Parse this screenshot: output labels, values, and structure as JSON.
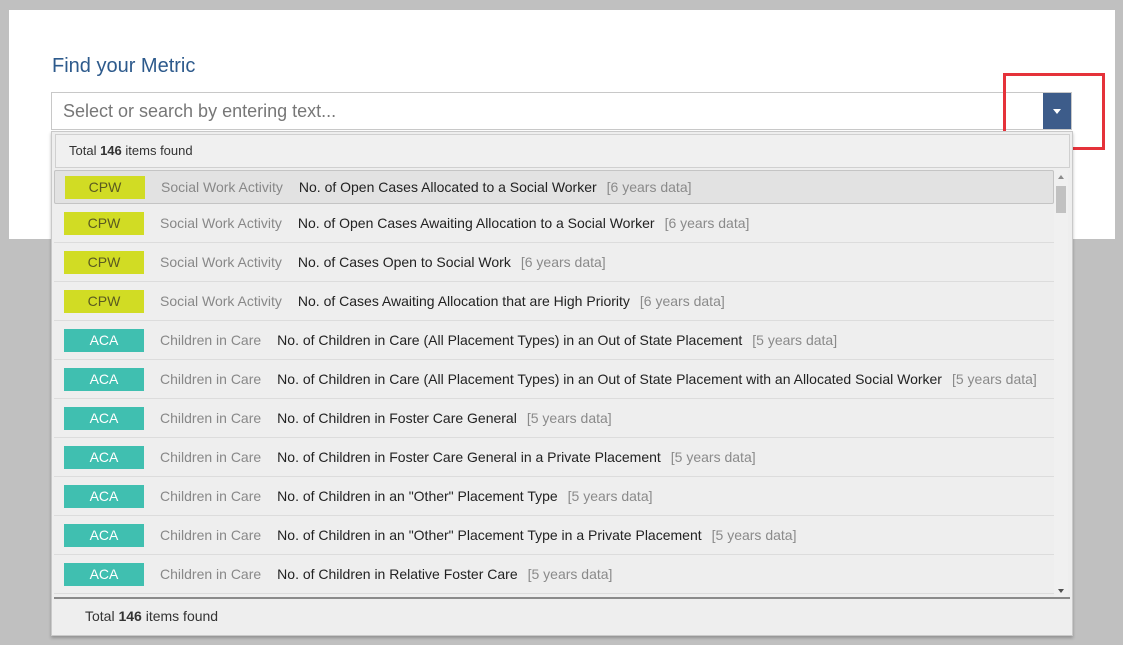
{
  "heading": "Find your Metric",
  "search": {
    "placeholder": "Select or search by entering text...",
    "value": ""
  },
  "total_top": {
    "prefix": "Total ",
    "count": "146",
    "suffix": " items found"
  },
  "total_bottom": {
    "prefix": "Total ",
    "count": "146",
    "suffix": " items found"
  },
  "icons": {
    "dropdown": "caret-down-icon",
    "scroll_up": "scroll-up-arrow",
    "scroll_down": "scroll-down-arrow"
  },
  "colors": {
    "cpw": "#d1dc24",
    "aca": "#40bfb0",
    "accent": "#3d5c8a",
    "highlight": "#e5323a"
  },
  "items": [
    {
      "tag": "CPW",
      "category": "Social Work Activity",
      "title": "No. of Open Cases Allocated to a Social Worker",
      "years": "[6 years data]"
    },
    {
      "tag": "CPW",
      "category": "Social Work Activity",
      "title": "No. of Open Cases Awaiting Allocation to a Social Worker",
      "years": "[6 years data]"
    },
    {
      "tag": "CPW",
      "category": "Social Work Activity",
      "title": "No. of Cases Open to Social Work",
      "years": "[6 years data]"
    },
    {
      "tag": "CPW",
      "category": "Social Work Activity",
      "title": "No. of Cases Awaiting Allocation that are High Priority",
      "years": "[6 years data]"
    },
    {
      "tag": "ACA",
      "category": "Children in Care",
      "title": "No. of Children in Care (All Placement Types) in an Out of State Placement",
      "years": "[5 years data]"
    },
    {
      "tag": "ACA",
      "category": "Children in Care",
      "title": "No. of Children in Care (All Placement Types) in an Out of State Placement with an Allocated Social Worker",
      "years": "[5 years data]"
    },
    {
      "tag": "ACA",
      "category": "Children in Care",
      "title": "No. of Children in Foster Care General",
      "years": "[5 years data]"
    },
    {
      "tag": "ACA",
      "category": "Children in Care",
      "title": "No. of Children in Foster Care General in a Private Placement",
      "years": "[5 years data]"
    },
    {
      "tag": "ACA",
      "category": "Children in Care",
      "title": "No. of Children in an \"Other\" Placement Type",
      "years": "[5 years data]"
    },
    {
      "tag": "ACA",
      "category": "Children in Care",
      "title": "No. of Children in an \"Other\" Placement Type in a Private Placement",
      "years": "[5 years data]"
    },
    {
      "tag": "ACA",
      "category": "Children in Care",
      "title": "No. of Children in Relative Foster Care",
      "years": "[5 years data]"
    }
  ]
}
